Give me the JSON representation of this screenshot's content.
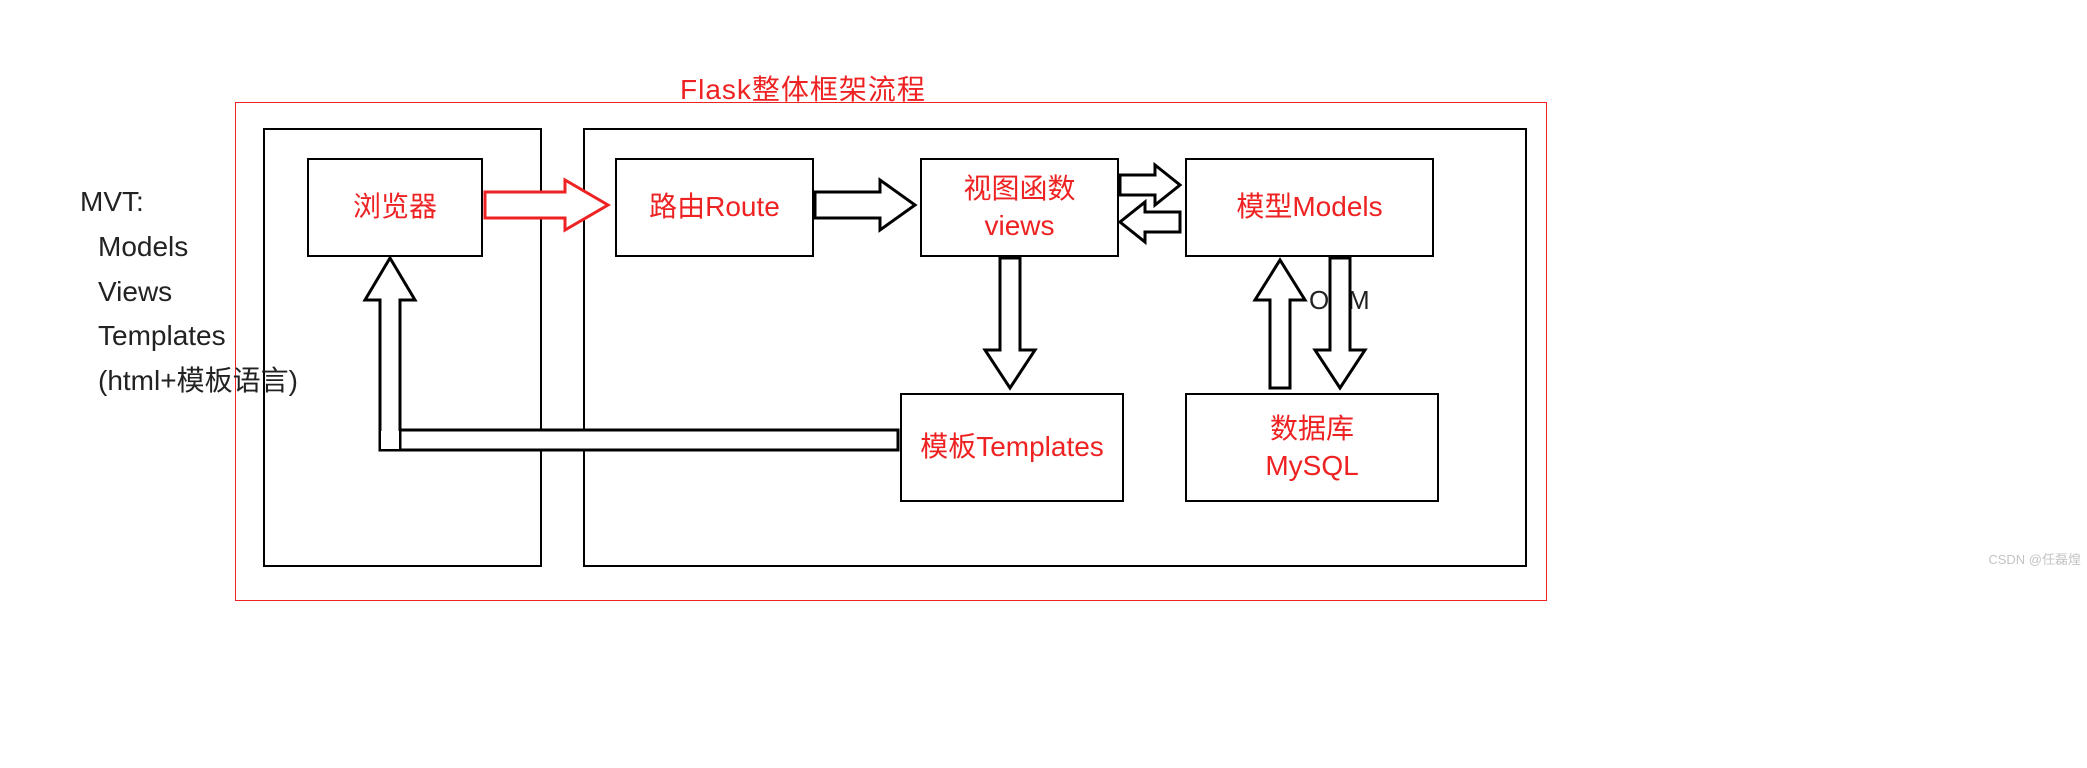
{
  "title": "Flask整体框架流程",
  "mvt": {
    "heading": "MVT:",
    "line1": "Models",
    "line2": "Views",
    "line3": "Templates",
    "line4": "(html+模板语言)"
  },
  "boxes": {
    "browser": "浏览器",
    "route": "路由Route",
    "views_l1": "视图函数",
    "views_l2": "views",
    "models": "模型Models",
    "templates": "模板Templates",
    "db_l1": "数据库",
    "db_l2": "MySQL"
  },
  "labels": {
    "orm": "ORM"
  },
  "watermark": "CSDN @任磊煌"
}
